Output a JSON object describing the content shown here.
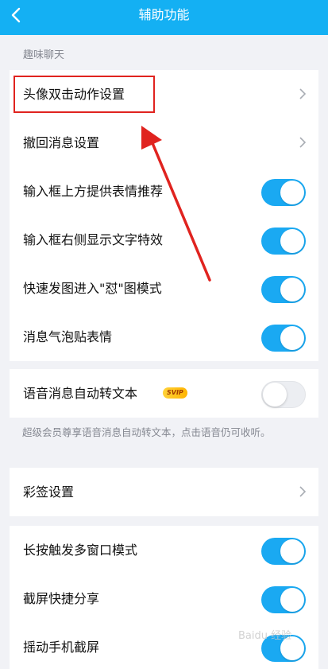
{
  "header": {
    "title": "辅助功能",
    "back_icon": "chevron-left-icon"
  },
  "section_fun_chat": {
    "label": "趣味聊天",
    "items": [
      {
        "label": "头像双击动作设置",
        "control": "chevron"
      },
      {
        "label": "撤回消息设置",
        "control": "chevron"
      },
      {
        "label": "输入框上方提供表情推荐",
        "control": "toggle",
        "on": true
      },
      {
        "label": "输入框右侧显示文字特效",
        "control": "toggle",
        "on": true
      },
      {
        "label": "快速发图进入\"怼\"图模式",
        "control": "toggle",
        "on": true
      },
      {
        "label": "消息气泡贴表情",
        "control": "toggle",
        "on": true
      }
    ]
  },
  "voice": {
    "label": "语音消息自动转文本",
    "badge": "SVIP",
    "on": false,
    "note": "超级会员尊享语音消息自动转文本，点击语音仍可收听。"
  },
  "caiqian": {
    "label": "彩签设置",
    "control": "chevron"
  },
  "section_misc": {
    "items": [
      {
        "label": "长按触发多窗口模式",
        "control": "toggle",
        "on": true
      },
      {
        "label": "截屏快捷分享",
        "control": "toggle",
        "on": true
      },
      {
        "label": "摇动手机截屏",
        "control": "toggle",
        "on": true
      }
    ]
  },
  "colors": {
    "header": "#14b0f3",
    "toggle_on": "#1aa9f2",
    "highlight": "#e0231f"
  },
  "watermark": "Baidu 经验"
}
